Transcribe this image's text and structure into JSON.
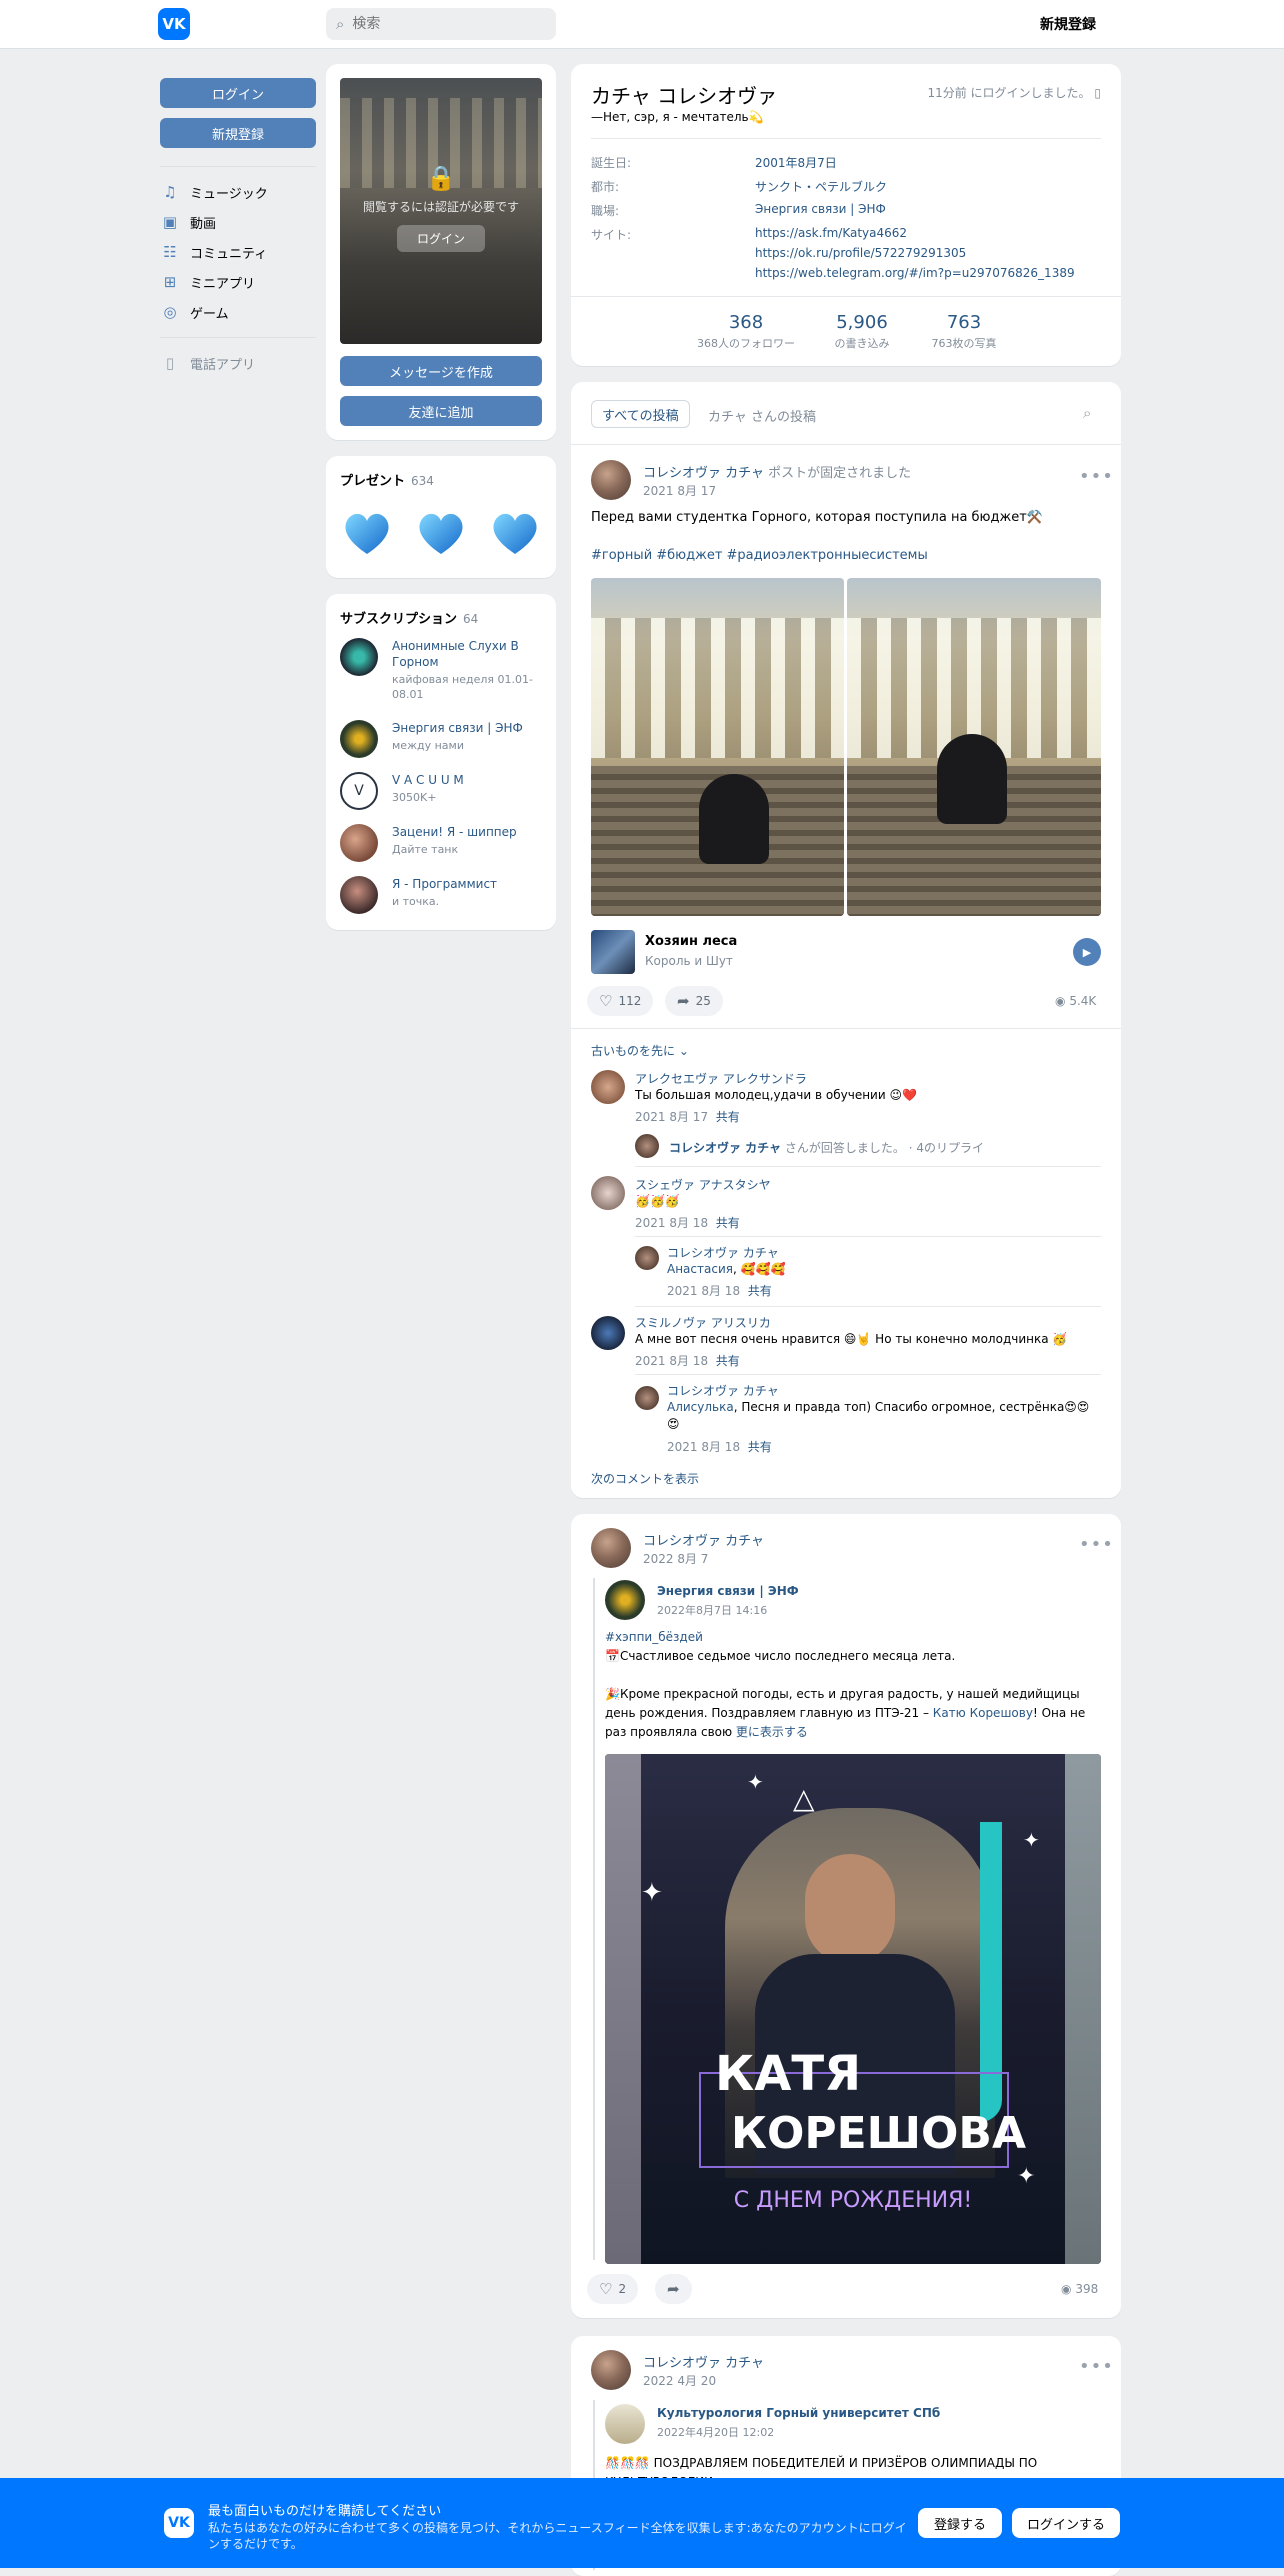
{
  "header": {
    "logo": "VK",
    "search_placeholder": "検索",
    "register": "新規登録"
  },
  "leftnav": {
    "login": "ログイン",
    "register": "新規登録",
    "items": [
      {
        "label": "ミュージック",
        "icon": "music-icon"
      },
      {
        "label": "動画",
        "icon": "video-icon"
      },
      {
        "label": "コミュニティ",
        "icon": "community-icon"
      },
      {
        "label": "ミニアプリ",
        "icon": "mini-apps-icon"
      },
      {
        "label": "ゲーム",
        "icon": "games-icon"
      }
    ],
    "phone_app": "電話アプリ"
  },
  "avatar_card": {
    "locked_text": "閲覧するには認証が必要です",
    "locked_login": "ログイン",
    "write_message": "メッセージを作成",
    "add_friend": "友達に追加"
  },
  "gifts": {
    "title": "プレゼント",
    "count": "634"
  },
  "subscriptions": {
    "title": "サブスクリプション",
    "count": "64",
    "items": [
      {
        "name": "Анонимные Слухи В Горном",
        "desc": "кайфовая неделя 01.01-08.01"
      },
      {
        "name": "Энергия связи | ЭНФ",
        "desc": "между нами"
      },
      {
        "name": "V A C U U M",
        "desc": "3050K+"
      },
      {
        "name": "Зацени! Я - шиппер",
        "desc": "Дайте танк"
      },
      {
        "name": "Я - Программист",
        "desc": "и точка."
      }
    ]
  },
  "profile": {
    "name": "カチャ コレシオヴァ",
    "status": "—Нет, сэр, я - мечтатель💫",
    "online": "11分前 にログインしました。",
    "info": {
      "birthday_label": "誕生日:",
      "birthday": "2001年8月7日",
      "city_label": "都市:",
      "city": "サンクト・ペテルブルク",
      "work_label": "職場:",
      "work": "Энергия связи | ЭНФ",
      "site_label": "サイト:",
      "sites": [
        "https://ask.fm/Katya4662",
        "https://ok.ru/profile/572279291305",
        "https://web.telegram.org/#/im?p=u297076826_1389"
      ]
    },
    "stats": [
      {
        "n": "368",
        "l": "368人のフォロワー"
      },
      {
        "n": "5,906",
        "l": "の書き込み"
      },
      {
        "n": "763",
        "l": "763枚の写真"
      }
    ]
  },
  "wall_tabs": {
    "all": "すべての投稿",
    "own": "カチャ さんの投稿"
  },
  "post1": {
    "author": "コレシオヴァ カチャ",
    "pinned": "ポストが固定されました",
    "date": "2021 8月 17",
    "text": "Перед вами студентка Горного, которая поступила на бюджет⚒️",
    "tags": "#горный #бюджет #радиоэлектронныесистемы",
    "track_title": "Хозяин леса",
    "track_artist": "Король и Шут",
    "likes": "112",
    "shares": "25",
    "views": "5.4K",
    "older_first": "古いものを先に ⌄",
    "next_comments": "次のコメントを表示"
  },
  "comments": [
    {
      "name": "アレクセエヴァ アレクサンドラ",
      "text": "Ты большая молодец,удачи в обучении 😉❤️",
      "date": "2021 8月 17",
      "share": "共有"
    },
    {
      "name": "コレシオヴァ カチャ",
      "replied": "さんが回答しました。",
      "replies": "· 4のリプライ"
    },
    {
      "name": "スシェヴァ アナスタシヤ",
      "text": "🥳🥳🥳",
      "date": "2021 8月 18",
      "share": "共有"
    },
    {
      "name": "コレシオヴァ カチャ",
      "mention": "Анастасия",
      "text": "🥰🥰🥰",
      "date": "2021 8月 18",
      "share": "共有"
    },
    {
      "name": "スミルノヴァ アリスリカ",
      "text": "А мне вот песня очень нравится 😄🤘 Но ты конечно молодчинка 🥳",
      "date": "2021 8月 18",
      "share": "共有"
    },
    {
      "name": "コレシオヴァ カチャ",
      "mention": "Алисулька",
      "text": ", Песня и правда топ) Спасибо огромное, сестрёнка😍😍😍",
      "date": "2021 8月 18",
      "share": "共有"
    }
  ],
  "post2": {
    "author": "コレシオヴァ カチャ",
    "date": "2022 8月 7",
    "repost_author": "Энергия связи | ЭНФ",
    "repost_date": "2022年8月7日 14:16",
    "tag": "#хэппи_бёздей",
    "line1": "📅Счастливое седьмое число последнего месяца лета.",
    "line2a": "🎉Кроме прекрасной погоды, есть и другая радость, у нашей медийщицы день рождения. Поздравляем главную из ПТЭ-21 – ",
    "mention": "Катю Корешову",
    "line2b": "! Она не раз проявляла свою ",
    "more": "更に表示する",
    "image_line1": "КАТЯ",
    "image_line2": "КОРЕШОВА",
    "image_line3": "С ДНЕМ РОЖДЕНИЯ!",
    "likes": "2",
    "views": "398"
  },
  "post3": {
    "author": "コレシオヴァ カチャ",
    "date": "2022 4月 20",
    "repost_author": "Культурология Горный университет СПб",
    "repost_date": "2022年4月20日 12:02",
    "text": "🎊🎊🎊 ПОЗДРАВЛЯЕМ ПОБЕДИТЕЛЕЙ И ПРИЗЁРОВ ОЛИМПИАДЫ ПО КУЛЬТУРОЛОГИИ"
  },
  "bottom": {
    "title": "最も面白いものだけを購読してください",
    "text": "私たちはあなたの好みに合わせて多くの投稿を見つけ、それからニュースフィード全体を収集します:あなたのアカウントにログインするだけです。",
    "register": "登録する",
    "login": "ログインする"
  },
  "colors": {
    "vk_blue": "#0077ff",
    "button": "#5181b8",
    "link": "#2a5885",
    "muted": "#818c99",
    "bg": "#edeef0"
  }
}
